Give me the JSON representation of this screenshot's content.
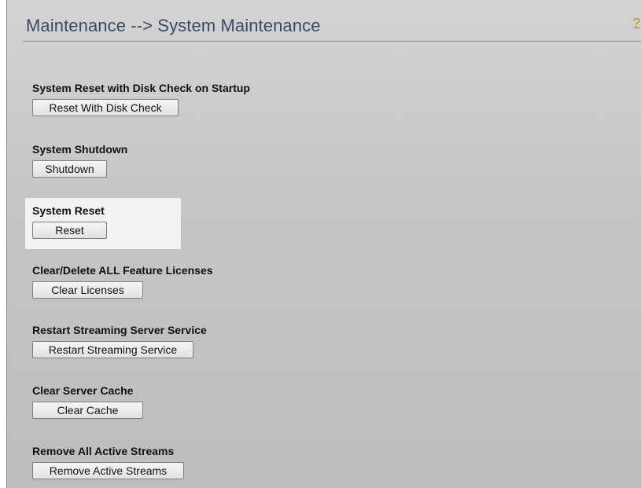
{
  "header": {
    "title": "Maintenance --> System Maintenance",
    "help_label": "?"
  },
  "sections": [
    {
      "label": "System Reset with Disk Check on Startup",
      "button": "Reset With Disk Check"
    },
    {
      "label": "System Shutdown",
      "button": "Shutdown"
    },
    {
      "label": "System Reset",
      "button": "Reset"
    },
    {
      "label": "Clear/Delete ALL Feature Licenses",
      "button": "Clear Licenses"
    },
    {
      "label": "Restart Streaming Server Service",
      "button": "Restart Streaming Service"
    },
    {
      "label": "Clear Server Cache",
      "button": "Clear Cache"
    },
    {
      "label": "Remove All Active Streams",
      "button": "Remove Active Streams"
    }
  ],
  "colors": {
    "title": "#3a4a66",
    "background": "#c6c6c6",
    "highlight": "#f2f2f2",
    "help_link": "#b8860b"
  }
}
